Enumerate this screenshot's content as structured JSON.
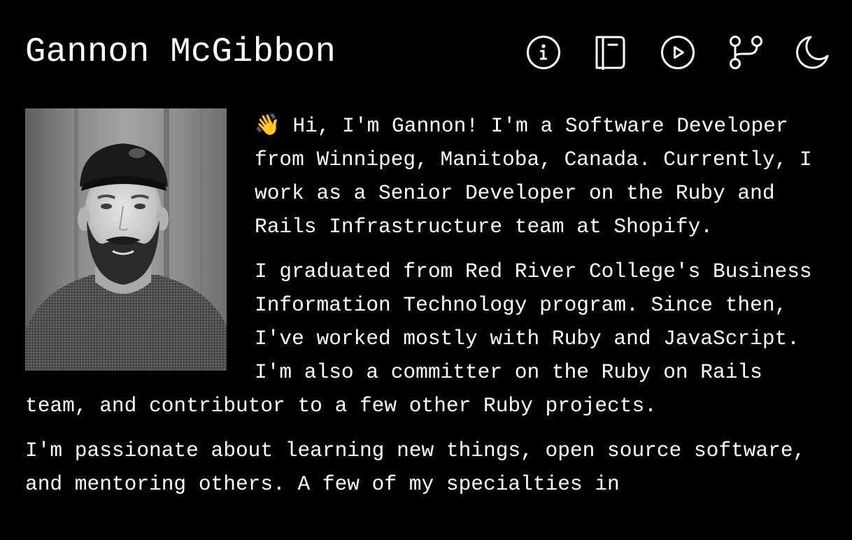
{
  "header": {
    "title": "Gannon McGibbon"
  },
  "nav": {
    "icons": [
      "info-icon",
      "notebook-icon",
      "play-icon",
      "git-branch-icon",
      "moon-icon"
    ]
  },
  "intro": {
    "paragraph_1": "👋 Hi, I'm Gannon! I'm a Software Developer from Winnipeg, Manitoba, Canada. Currently, I work as a Senior Developer on the Ruby and Rails Infrastructure team at Shopify.",
    "paragraph_2": "I graduated from Red River College's Business Information Technology program. Since then, I've worked mostly with Ruby and JavaScript. I'm also a committer on the Ruby on Rails team, and contributor to a few other Ruby projects.",
    "paragraph_3": "I'm passionate about learning new things, open source software, and mentoring others. A few of my specialties in"
  },
  "colors": {
    "background": "#000000",
    "text": "#ffffff"
  }
}
